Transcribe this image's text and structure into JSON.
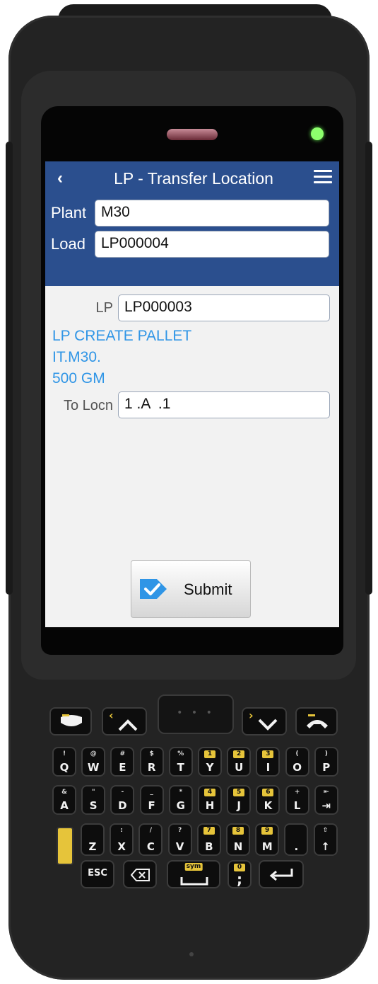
{
  "app": {
    "title": "LP - Transfer Location",
    "back_icon": "back-arrow-icon",
    "menu_icon": "hamburger-menu-icon",
    "header_color": "#2b4f8e",
    "accent_text_color": "#2f95e6"
  },
  "header_fields": {
    "plant": {
      "label": "Plant",
      "value": "M30"
    },
    "load": {
      "label": "Load",
      "value": "LP000004"
    }
  },
  "form": {
    "lp": {
      "label": "LP",
      "value": "LP000003"
    },
    "info_lines": [
      "LP CREATE PALLET",
      "IT.M30.",
      "500 GM"
    ],
    "to_locn": {
      "label": "To Locn",
      "value": "1 .A  .1"
    }
  },
  "submit": {
    "label": "Submit",
    "icon": "checkmark-tag-icon"
  },
  "keypad": {
    "nav": {
      "left_arrow": "‹",
      "right_arrow": "›"
    },
    "row1": [
      {
        "main": "Q",
        "sub": "!"
      },
      {
        "main": "W",
        "sub": "@"
      },
      {
        "main": "E",
        "sub": "#"
      },
      {
        "main": "R",
        "sub": "$"
      },
      {
        "main": "T",
        "sub": "%"
      },
      {
        "main": "Y",
        "sub": "1"
      },
      {
        "main": "U",
        "sub": "2"
      },
      {
        "main": "I",
        "sub": "3"
      },
      {
        "main": "O",
        "sub": "("
      },
      {
        "main": "P",
        "sub": ")"
      }
    ],
    "row2": [
      {
        "main": "A",
        "sub": "&"
      },
      {
        "main": "S",
        "sub": "\""
      },
      {
        "main": "D",
        "sub": "-"
      },
      {
        "main": "F",
        "sub": "_"
      },
      {
        "main": "G",
        "sub": "*"
      },
      {
        "main": "H",
        "sub": "4"
      },
      {
        "main": "J",
        "sub": "5"
      },
      {
        "main": "K",
        "sub": "6"
      },
      {
        "main": "L",
        "sub": "+"
      },
      {
        "main": "⇥",
        "sub": "⇤"
      }
    ],
    "row3": [
      {
        "main": "Z",
        "sub": ""
      },
      {
        "main": "X",
        "sub": ":"
      },
      {
        "main": "C",
        "sub": "/"
      },
      {
        "main": "V",
        "sub": "?"
      },
      {
        "main": "B",
        "sub": "7"
      },
      {
        "main": "N",
        "sub": "8"
      },
      {
        "main": "M",
        "sub": "9"
      },
      {
        "main": ".",
        "sub": ""
      },
      {
        "main": "↑",
        "sub": "⇧"
      }
    ],
    "esc_label": "ESC",
    "sym_label": "sym",
    "semicolon_label": ";",
    "zero_label": "0"
  }
}
